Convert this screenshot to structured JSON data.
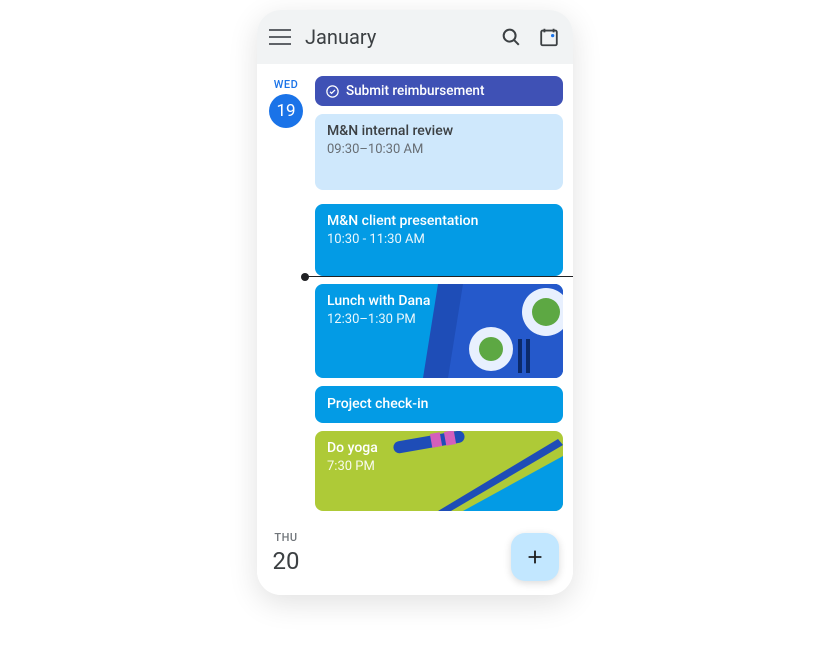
{
  "header": {
    "month_label": "January"
  },
  "days": {
    "today": {
      "name": "WED",
      "number": "19"
    },
    "next": {
      "name": "THU",
      "number": "20"
    }
  },
  "events": {
    "task": {
      "title": "Submit reimbursement"
    },
    "review": {
      "title": "M&N internal review",
      "time": "09:30–10:30 AM"
    },
    "presentation": {
      "title": "M&N client presentation",
      "time": "10:30 - 11:30 AM"
    },
    "lunch": {
      "title": "Lunch with Dana",
      "time": "12:30–1:30 PM"
    },
    "checkin": {
      "title": "Project check-in"
    },
    "yoga": {
      "title": "Do yoga",
      "time": "7:30 PM"
    }
  },
  "colors": {
    "primary_blue": "#1a73e8",
    "event_blue": "#039be5",
    "task_indigo": "#3f51b5",
    "soft_blue": "#cfe8fc",
    "olive_green": "#aeca37",
    "fab_bg": "#c2e7ff"
  }
}
